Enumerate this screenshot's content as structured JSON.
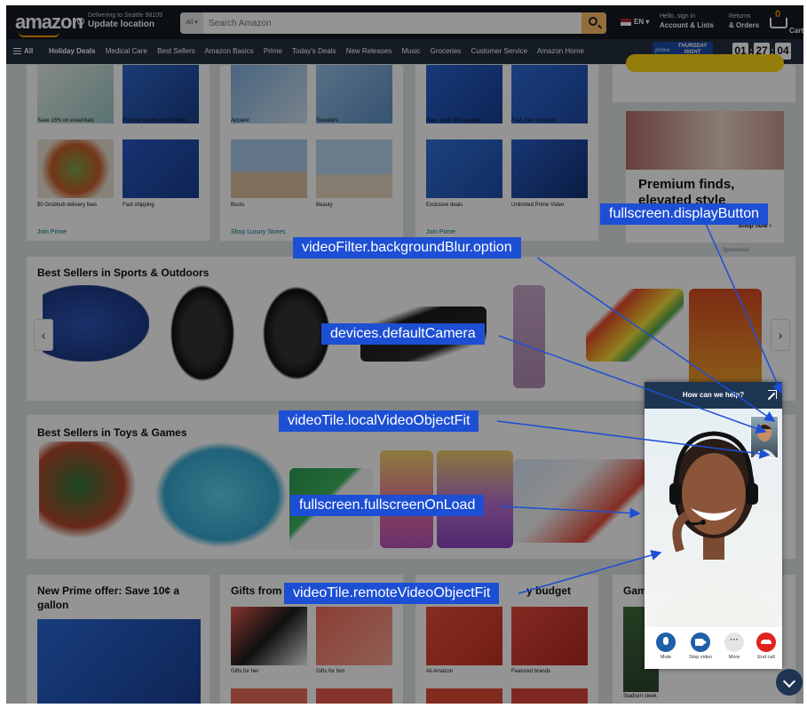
{
  "header": {
    "logo": "amazon",
    "deliver_line1": "Delivering to Seattle 98109",
    "deliver_line2": "Update location",
    "search_category": "All",
    "search_placeholder": "Search Amazon",
    "language": "EN",
    "account_line1": "Hello, sign in",
    "account_line2": "Account & Lists",
    "orders_line1": "Returns",
    "orders_line2": "& Orders",
    "cart_count": "0",
    "cart_label": "Cart"
  },
  "nav": {
    "all_label": "All",
    "items": [
      "Holiday Deals",
      "Medical Care",
      "Best Sellers",
      "Amazon Basics",
      "Prime",
      "Today's Deals",
      "New Releases",
      "Music",
      "Groceries",
      "Customer Service",
      "Amazon Home"
    ],
    "promo_prime": "prime",
    "promo_text": "THURSDAY NIGHT FOOTBALL",
    "countdown": [
      "01",
      "27",
      "04"
    ]
  },
  "cards": {
    "card1": {
      "captions": [
        "Save 15% on essentials",
        "Popular movies and shows",
        "$0 Grubhub delivery fees",
        "Fast shipping"
      ],
      "link": "Join Prime"
    },
    "card2": {
      "captions": [
        "Apparel",
        "Sweaters",
        "Boots",
        "Beauty"
      ],
      "link": "Shop Luxury Stores"
    },
    "card3": {
      "captions": [
        "New: save 10¢ a gallon",
        "Fast, free shipping",
        "Exclusive deals",
        "Unlimited Prime Video"
      ],
      "link": "Join Prime"
    },
    "ad": {
      "title": "Premium finds, elevated style",
      "shop": "Shop now ›",
      "sponsored": "Sponsored"
    },
    "sports_title": "Best Sellers in Sports & Outdoors",
    "toys_title": "Best Sellers in Toys & Games",
    "prime_offer_title": "New Prime offer:  Save 10¢ a gallon",
    "gifts_title": "Gifts from",
    "budget_title": "y budget",
    "gam_title": "Gam",
    "gift_captions": [
      "Gifts for her",
      "Gifts for him",
      "All Amazon",
      "Featured brands"
    ],
    "stadium_caption": "Stadium sleek"
  },
  "widget": {
    "title": "How can we help?",
    "controls": [
      {
        "label": "Mute",
        "icon": "mic-icon",
        "color": "#1f5fa8"
      },
      {
        "label": "Stop video",
        "icon": "camera-icon",
        "color": "#1f5fa8"
      },
      {
        "label": "More",
        "icon": "more-icon",
        "color": "#e4e4e4"
      },
      {
        "label": "End call",
        "icon": "end-call-icon",
        "color": "#e0231c"
      }
    ]
  },
  "annotations": [
    "fullscreen.displayButton",
    "videoFilter.backgroundBlur.option",
    "devices.defaultCamera",
    "videoTile.localVideoObjectFit",
    "fullscreen.fullscreenOnLoad",
    "videoTile.remoteVideoObjectFit"
  ],
  "colors": {
    "annotation_bg": "#1d4fd4",
    "annotation_arrow": "#1d4fd4",
    "header_bg": "#131921",
    "nav_bg": "#232f3e",
    "widget_header": "#1e3552",
    "end_call": "#e0231c"
  }
}
